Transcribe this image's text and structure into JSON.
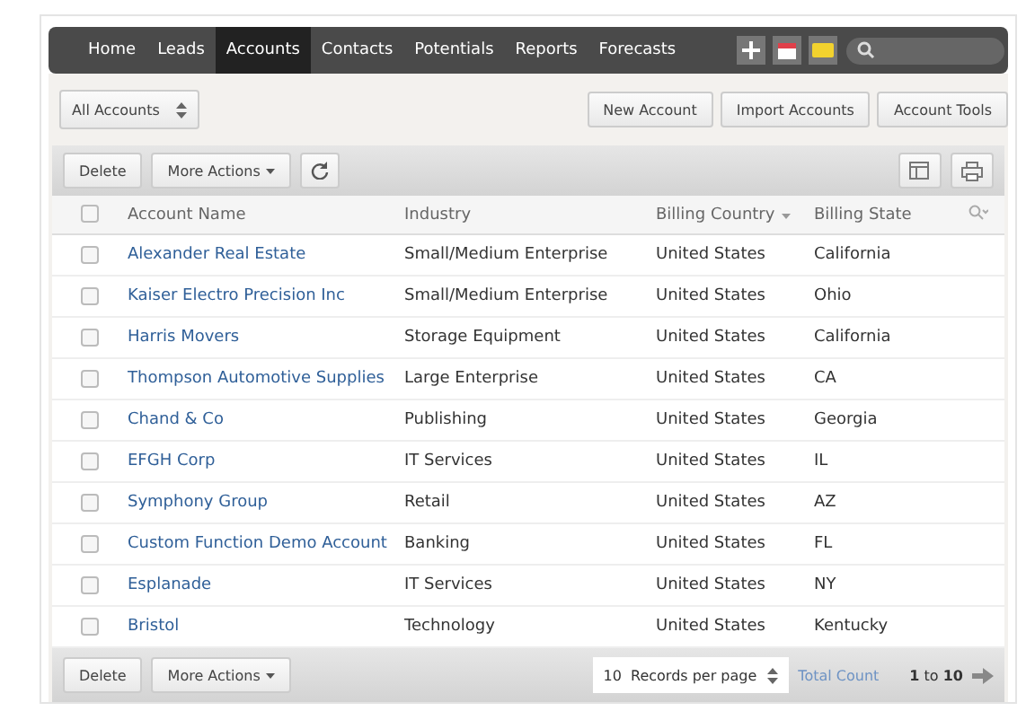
{
  "nav": {
    "tabs": [
      {
        "label": "Home",
        "selected": false
      },
      {
        "label": "Leads",
        "selected": false
      },
      {
        "label": "Accounts",
        "selected": true
      },
      {
        "label": "Contacts",
        "selected": false
      },
      {
        "label": "Potentials",
        "selected": false
      },
      {
        "label": "Reports",
        "selected": false
      },
      {
        "label": "Forecasts",
        "selected": false
      }
    ]
  },
  "toolbar": {
    "view_select": "All Accounts",
    "buttons": [
      "New Account",
      "Import Accounts",
      "Account Tools"
    ]
  },
  "actions": {
    "delete": "Delete",
    "more": "More Actions"
  },
  "table": {
    "select_all_checked": false,
    "columns": [
      "Account Name",
      "Industry",
      "Billing Country",
      "Billing State"
    ],
    "rows": [
      {
        "checked": false,
        "cells": [
          "Alexander Real Estate",
          "Small/Medium Enterprise",
          "United States",
          "California"
        ]
      },
      {
        "checked": false,
        "cells": [
          "Kaiser Electro Precision Inc",
          "Small/Medium Enterprise",
          "United States",
          "Ohio"
        ]
      },
      {
        "checked": false,
        "cells": [
          "Harris Movers",
          "Storage Equipment",
          "United States",
          "California"
        ]
      },
      {
        "checked": false,
        "cells": [
          "Thompson Automotive Supplies",
          "Large Enterprise",
          "United States",
          "CA"
        ]
      },
      {
        "checked": false,
        "cells": [
          "Chand & Co",
          "Publishing",
          "United States",
          "Georgia"
        ]
      },
      {
        "checked": false,
        "cells": [
          "EFGH Corp",
          "IT Services",
          "United States",
          "IL"
        ]
      },
      {
        "checked": false,
        "cells": [
          "Symphony Group",
          "Retail",
          "United States",
          "AZ"
        ]
      },
      {
        "checked": false,
        "cells": [
          "Custom Function Demo Account",
          "Banking",
          "United States",
          "FL"
        ]
      },
      {
        "checked": false,
        "cells": [
          "Esplanade",
          "IT Services",
          "United States",
          "NY"
        ]
      },
      {
        "checked": false,
        "cells": [
          "Bristol",
          "Technology",
          "United States",
          "Kentucky"
        ]
      }
    ]
  },
  "footer": {
    "delete": "Delete",
    "more": "More Actions",
    "per_page": "10",
    "per_page_label": "Records per page",
    "total_count": "Total Count",
    "range": "**1** to **10**"
  }
}
